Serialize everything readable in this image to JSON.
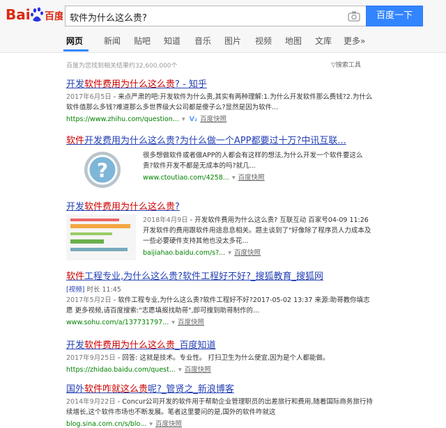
{
  "logo_text": "百度",
  "search": {
    "query": "软件为什么这么贵?",
    "button_label": "百度一下"
  },
  "tabs": [
    "网页",
    "新闻",
    "贴吧",
    "知道",
    "音乐",
    "图片",
    "视频",
    "地图",
    "文库",
    "更多»"
  ],
  "stats_text": "百度为您找到相关结果约32,600,000个",
  "tools_label": "搜索工具",
  "snapshot_label": "百度快照",
  "results": [
    {
      "title_parts": [
        "开发",
        "软件费用为什么这么贵",
        "? - 知乎"
      ],
      "date": "2017年6月5日",
      "snippet": "- 来点严肃的吧:开发软件为什么贵,其实有两种理解:1.为什么开发软件那么费钱?2.为什么软件值那么多钱?难道那么多世界级大公司都是傻子么?显然是因为软件...",
      "url": "https://www.zhihu.com/question..."
    },
    {
      "title_parts": [
        "软件",
        "开发费用为什么这么贵",
        "?为什么做一个APP都要过十万?中讯互联..."
      ],
      "snippet": "很多想做软件或者做APP的人都会有这样的想法,为什么开发一个软件要这么贵?软件开发不都是无成本的吗?就几...",
      "url": "www.ctoutiao.com/4258..."
    },
    {
      "title_parts": [
        "开发",
        "软件费用为什么这么贵",
        "?"
      ],
      "date": "2018年4月9日",
      "snippet": "- 开发软件费用为什么这么贵? 互联互动 百家号04-09 11:26 开发软件的费用跟软件用途息息相关。题主谈到了\"好像除了程序员人力成本及一些必要硬件支持其他也没太多花...",
      "url": "baijiahao.baidu.com/s?..."
    },
    {
      "title_parts": [
        "软件",
        "工程专业,为什么这么贵?软件",
        "工程好不好?_搜狐教育_搜狐网"
      ],
      "video_tag": "[视频]",
      "duration": "时长 11:45",
      "date": "2017年5月2日",
      "snippet": "- 软件工程专业,为什么这么贵?软件工程好不好?2017-05-02 13:37 来源:助哥教你填志愿 更多视频,请百度搜索:\"志愿填报找助哥\",即可搜到助哥制作的...",
      "url": "www.sohu.com/a/137731797..."
    },
    {
      "title_parts": [
        "开发",
        "软件费用为什么这么贵",
        "_百度知道"
      ],
      "date": "2017年9月25日",
      "snippet": "- 回答: 这就是技术。专业性。 打扫卫生为什么便宜,因为是个人都能做。",
      "url": "https://zhidao.baidu.com/quest..."
    },
    {
      "title_parts": [
        "国外",
        "软件咋就这么贵",
        "呢?_管贤之_新浪博客"
      ],
      "date": "2014年9月22日",
      "snippet": "- Concur公司开发的软件用于帮助企业管理职员的出差旅行和费用,随着国际商务旅行持续增长,这个软件市场也不断发展。笔者这里要问的是,国外的软件咋就这",
      "url": "blog.sina.com.cn/s/blo..."
    }
  ],
  "colors": {
    "link": "#2440b3",
    "highlight": "#cc0000",
    "url_green": "#008000",
    "brand_blue": "#3385ff",
    "baidu_red": "#de2910"
  }
}
